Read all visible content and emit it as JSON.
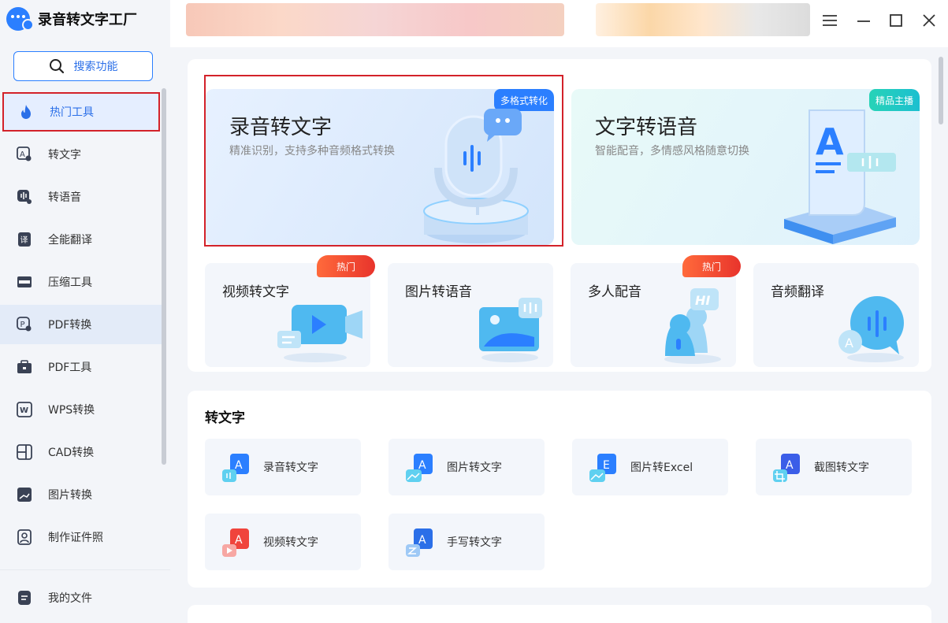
{
  "app": {
    "title": "录音转文字工厂"
  },
  "search": {
    "label": "搜索功能"
  },
  "sidebar": {
    "items": [
      {
        "label": "热门工具",
        "icon": "fire-icon"
      },
      {
        "label": "转文字",
        "icon": "text-icon"
      },
      {
        "label": "转语音",
        "icon": "voice-icon"
      },
      {
        "label": "全能翻译",
        "icon": "translate-icon"
      },
      {
        "label": "压缩工具",
        "icon": "compress-icon"
      },
      {
        "label": "PDF转换",
        "icon": "pdf-icon"
      },
      {
        "label": "PDF工具",
        "icon": "toolbox-icon"
      },
      {
        "label": "WPS转换",
        "icon": "wps-icon"
      },
      {
        "label": "CAD转换",
        "icon": "cad-icon"
      },
      {
        "label": "图片转换",
        "icon": "image-icon"
      },
      {
        "label": "制作证件照",
        "icon": "id-photo-icon"
      }
    ],
    "bottom": {
      "label": "我的文件",
      "icon": "file-icon"
    }
  },
  "hero": [
    {
      "title": "录音转文字",
      "subtitle": "精准识别，支持多种音频格式转换",
      "tag": "多格式转化"
    },
    {
      "title": "文字转语音",
      "subtitle": "智能配音，多情感风格随意切换",
      "tag": "精品主播"
    }
  ],
  "quick": [
    {
      "title": "视频转文字",
      "badge": "热门"
    },
    {
      "title": "图片转语音",
      "badge": ""
    },
    {
      "title": "多人配音",
      "badge": "热门"
    },
    {
      "title": "音频翻译",
      "badge": ""
    }
  ],
  "section": {
    "title": "转文字",
    "tools": [
      {
        "label": "录音转文字",
        "letter": "A"
      },
      {
        "label": "图片转文字",
        "letter": "A"
      },
      {
        "label": "图片转Excel",
        "letter": "E"
      },
      {
        "label": "截图转文字",
        "letter": "A"
      },
      {
        "label": "视频转文字",
        "letter": "A"
      },
      {
        "label": "手写转文字",
        "letter": "A"
      }
    ]
  },
  "quick_art": {
    "hi": "HI",
    "a": "A"
  },
  "colors": {
    "accent": "#2b7fff",
    "highlight": "#d3222a",
    "hot": "#e8342c",
    "teal": "#1cc9b4"
  }
}
